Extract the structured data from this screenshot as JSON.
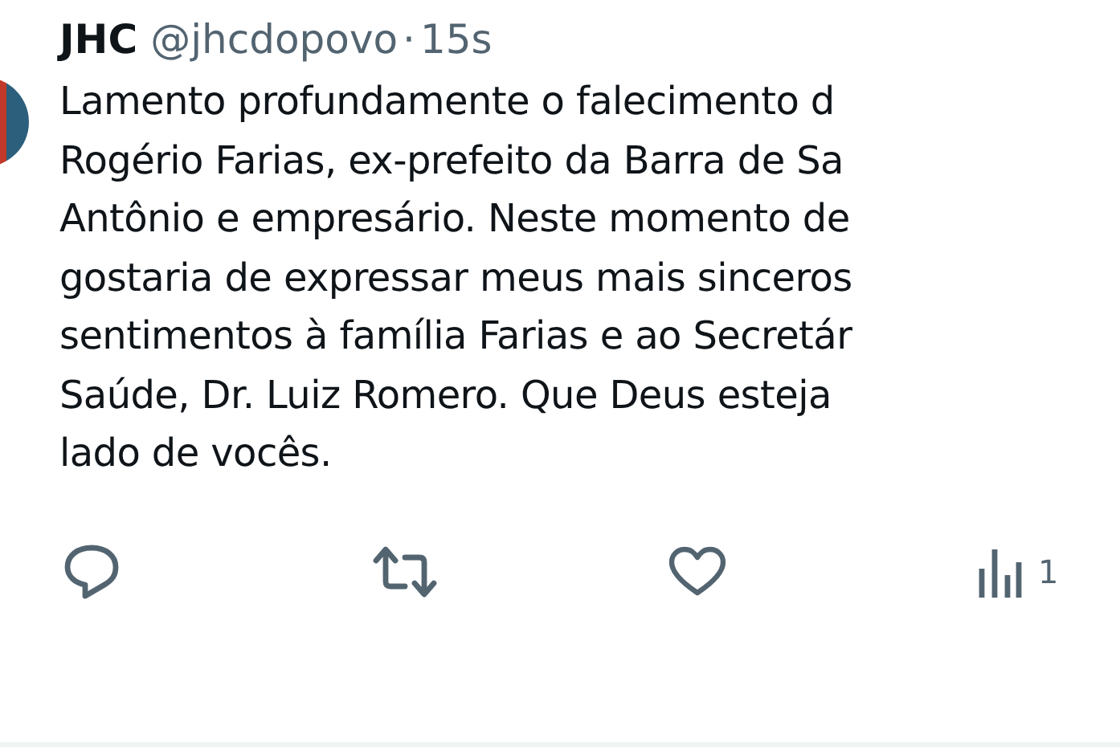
{
  "post": {
    "author_name": "JHC",
    "handle": "@jhcdopovo",
    "separator": "·",
    "time": "15s",
    "text_lines": [
      "Lamento profundamente o falecimento d",
      "Rogério Farias, ex-prefeito da Barra de Sa",
      "Antônio e empresário. Neste momento de",
      "gostaria de expressar meus mais sinceros",
      "sentimentos à família Farias e ao Secretár",
      "Saúde, Dr. Luiz Romero. Que Deus esteja",
      "lado de vocês."
    ],
    "actions": [
      {
        "kind": "reply"
      },
      {
        "kind": "repost"
      },
      {
        "kind": "like"
      },
      {
        "kind": "views",
        "count": "1"
      }
    ]
  }
}
